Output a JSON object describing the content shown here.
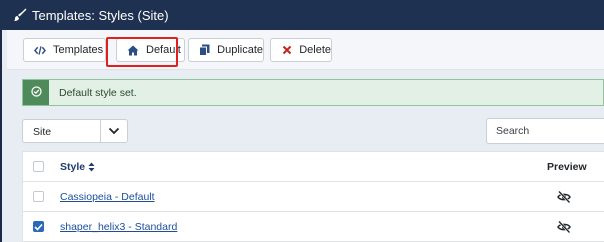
{
  "header": {
    "title": "Templates: Styles (Site)",
    "icon": "paint-brush-icon"
  },
  "toolbar": {
    "templates_label": "Templates",
    "default_label": "Default",
    "duplicate_label": "Duplicate",
    "delete_label": "Delete",
    "templates_icon": "code-icon",
    "default_icon": "home-icon",
    "duplicate_icon": "copy-icon",
    "delete_icon": "close-icon",
    "delete_icon_color": "#c0261e"
  },
  "alert": {
    "message": "Default style set.",
    "icon": "check-circle-icon",
    "accent_color": "#4f8b5a"
  },
  "filter": {
    "client_value": "Site",
    "search_placeholder": "Search"
  },
  "table": {
    "columns": {
      "style": "Style",
      "preview": "Preview"
    },
    "rows": [
      {
        "name": "Cassiopeia - Default",
        "checked": false,
        "preview_icon": "eye-slash-icon"
      },
      {
        "name": "shaper_helix3 - Standard",
        "checked": true,
        "preview_icon": "eye-slash-icon"
      }
    ]
  }
}
